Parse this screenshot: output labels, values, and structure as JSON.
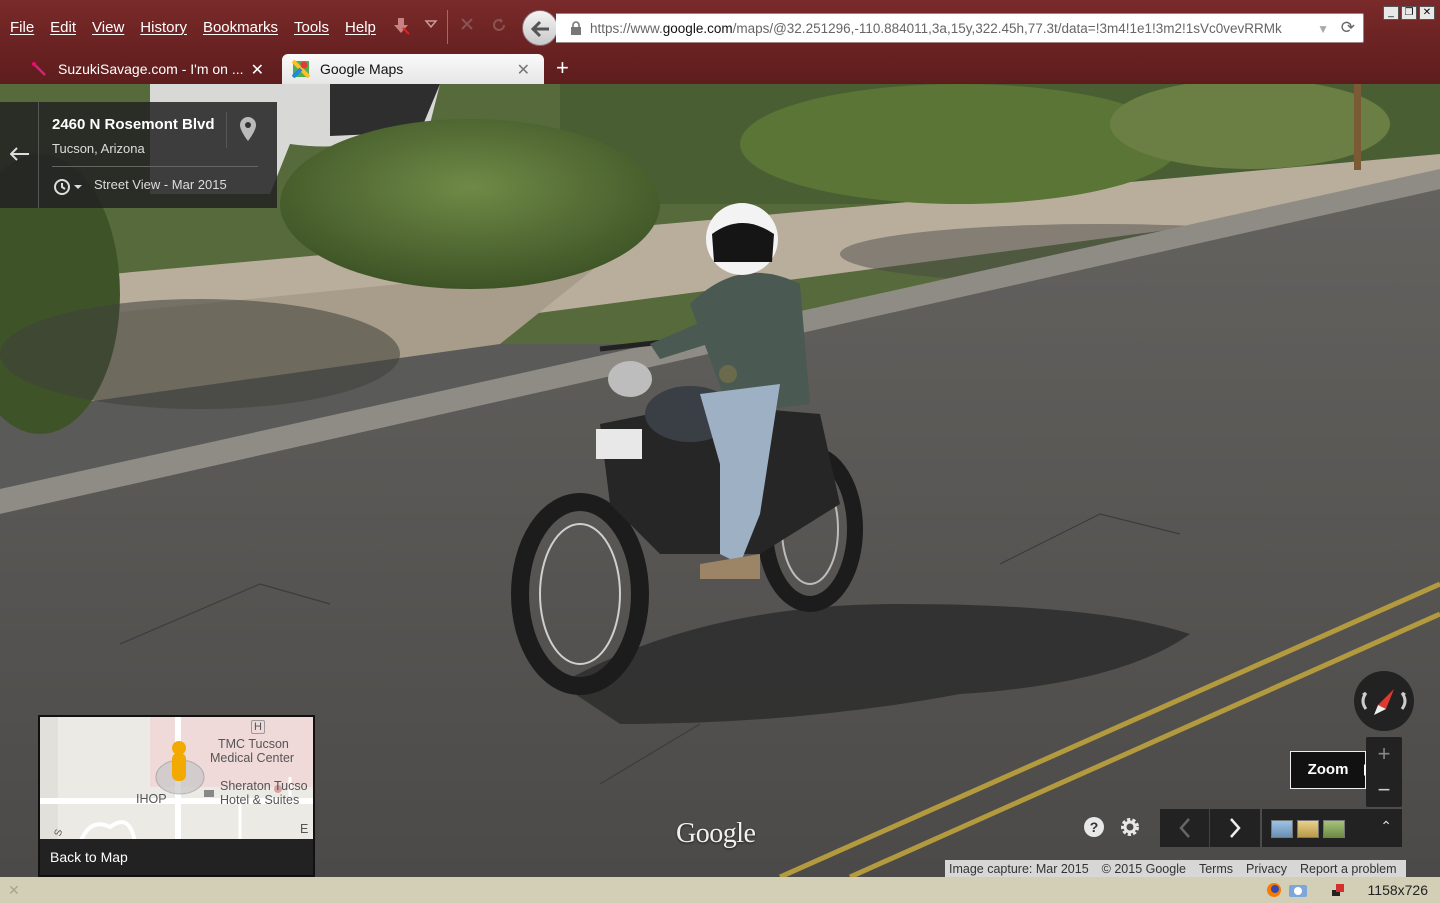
{
  "menu": {
    "items": [
      "File",
      "Edit",
      "View",
      "History",
      "Bookmarks",
      "Tools",
      "Help"
    ]
  },
  "urlbar": {
    "prefix": "https://www.",
    "domain": "google.com",
    "rest": "/maps/@32.251296,-110.884011,3a,15y,322.45h,77.3t/data=!3m4!1e1!3m2!1sVc0vevRRMk"
  },
  "tabs": [
    {
      "label": "SuzukiSavage.com - I'm on ...",
      "active": false
    },
    {
      "label": "Google Maps",
      "active": true
    }
  ],
  "address_card": {
    "title": "2460 N Rosemont Blvd",
    "subtitle": "Tucson, Arizona",
    "streetview_label": "Street View - Mar 2015"
  },
  "minimap": {
    "label": "Back to Map",
    "places": {
      "tmc_line1": "TMC Tucson",
      "tmc_line2": "Medical Center",
      "sheraton_line1": "Sheraton Tucso",
      "sheraton_line2": "Hotel & Suites",
      "ihop": "IHOP",
      "hospital_marker": "H",
      "edge_e": "E",
      "edge_s": "S"
    }
  },
  "controls": {
    "zoom_tooltip": "Zoom",
    "zoom_in": "+",
    "zoom_out": "−"
  },
  "watermark": "Google",
  "footer": {
    "image_capture": "Image capture: Mar 2015",
    "copyright": "© 2015 Google",
    "terms": "Terms",
    "privacy": "Privacy",
    "report": "Report a problem"
  },
  "statusbar": {
    "dimensions": "1158x726"
  },
  "colors": {
    "chrome": "#6a2222",
    "statusbar": "#d3cfb6",
    "compass_needle": "#e03a2f"
  }
}
